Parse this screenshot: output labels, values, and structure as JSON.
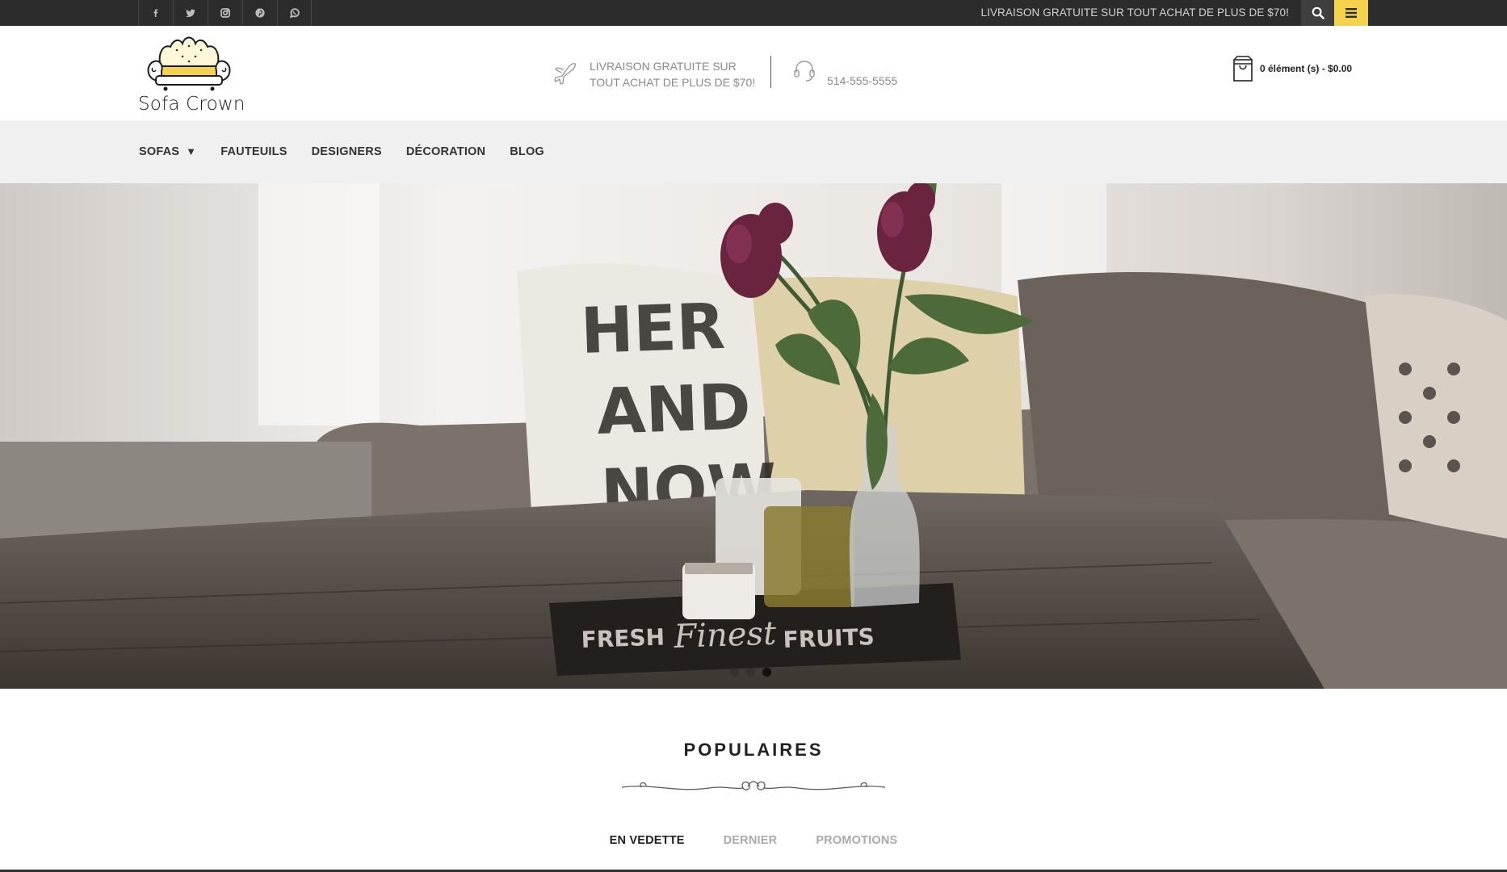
{
  "topbar": {
    "social_icons": [
      "facebook-icon",
      "twitter-icon",
      "instagram-icon",
      "pinterest-icon",
      "whatsapp-icon"
    ],
    "promo": "LIVRAISON GRATUITE SUR TOUT ACHAT DE PLUS DE $70!",
    "accent_color": "#f5d24c"
  },
  "header": {
    "logo_text": "Sofa Crown",
    "shipping_line1": "LIVRAISON GRATUITE SUR",
    "shipping_line2": "TOUT ACHAT DE PLUS DE $70!",
    "phone": "514-555-5555",
    "cart": "0 élément (s) - $0.00"
  },
  "nav": {
    "items": [
      "SOFAS",
      "FAUTEUILS",
      "DESIGNERS",
      "DÉCORATION",
      "BLOG"
    ],
    "sofas_caret": "▼"
  },
  "hero": {
    "slides": 3,
    "active_slide": 3
  },
  "section": {
    "title": "POPULAIRES",
    "tabs": [
      "EN VEDETTE",
      "DERNIER",
      "PROMOTIONS"
    ],
    "active_tab": "EN VEDETTE"
  }
}
